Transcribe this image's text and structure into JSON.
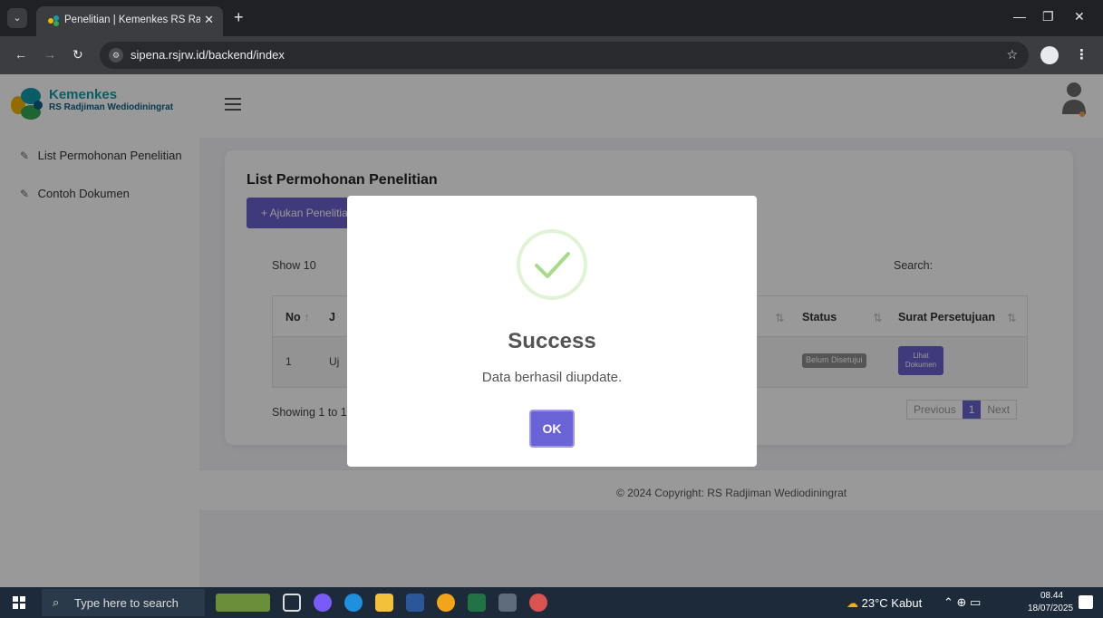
{
  "browser": {
    "tab_title": "Penelitian | Kemenkes RS Radjiman",
    "tab_close": "✕",
    "new_tab": "+",
    "url": "sipena.rsjrw.id/backend/index"
  },
  "brand": {
    "title": "Kemenkes",
    "subtitle": "RS Radjiman Wediodiningrat",
    "accent": "#139ca8"
  },
  "sidebar": {
    "items": [
      {
        "label": "List Permohonan Penelitian",
        "icon": "edit-icon"
      },
      {
        "label": "Contoh Dokumen",
        "icon": "edit-icon"
      }
    ]
  },
  "main": {
    "title": "List Permohonan Penelitian",
    "add_button": "+ Ajukan Penelitian",
    "show_label": "Show  10",
    "search_label": "Search:",
    "columns": {
      "no": "No",
      "jenis": "J",
      "status": "Status",
      "surat": "Surat Persetujuan"
    },
    "rows": [
      {
        "no": "1",
        "jenis": "Uj",
        "status": "Belum Disetujui",
        "surat_button": "Lihat Dokumen"
      }
    ],
    "showing": "Showing 1 to 1",
    "pagination": {
      "previous": "Previous",
      "current": "1",
      "next": "Next"
    },
    "primary_color": "#6861ce"
  },
  "footer": {
    "text": "© 2024 Copyright: RS Radjiman Wediodiningrat"
  },
  "modal": {
    "title": "Success",
    "message": "Data berhasil diupdate.",
    "ok_label": "OK",
    "icon": "success-check-icon"
  },
  "taskbar": {
    "search_placeholder": "Type here to search",
    "weather": "23°C  Kabut",
    "time": "08.44",
    "date": "18/07/2025"
  }
}
